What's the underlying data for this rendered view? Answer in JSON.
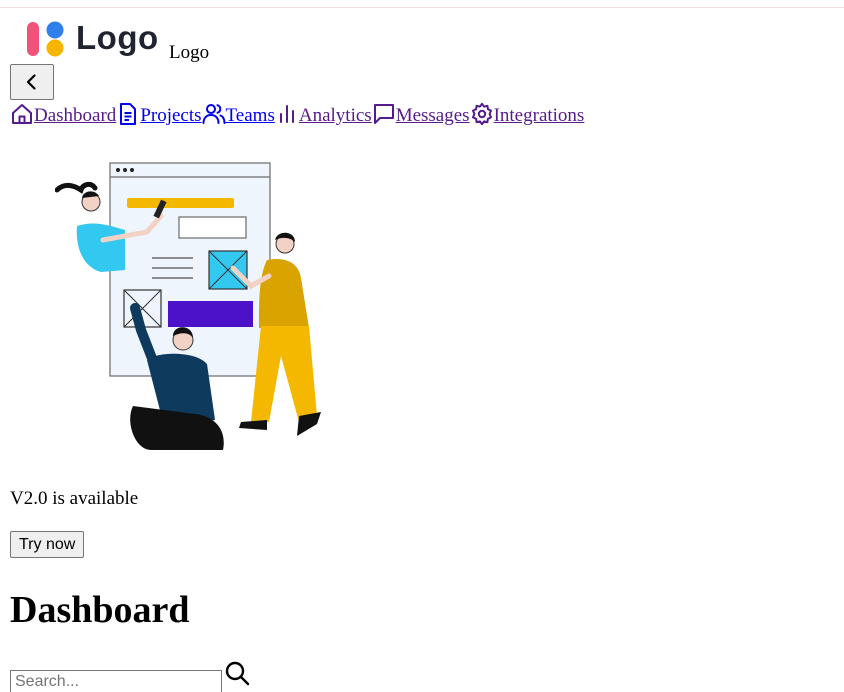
{
  "logo": {
    "wordmark": "Logo",
    "alt_text": "Logo"
  },
  "nav": {
    "back_icon": "chevron-left-icon",
    "items": [
      {
        "label": "Dashboard",
        "icon": "home-icon",
        "visited": true
      },
      {
        "label": "Projects",
        "icon": "document-icon",
        "visited": false
      },
      {
        "label": "Teams",
        "icon": "users-icon",
        "visited": false
      },
      {
        "label": "Analytics",
        "icon": "bar-chart-icon",
        "visited": true
      },
      {
        "label": "Messages",
        "icon": "message-icon",
        "visited": true
      },
      {
        "label": "Integrations",
        "icon": "gear-icon",
        "visited": true
      }
    ]
  },
  "promo": {
    "text": "V2.0 is available",
    "button_label": "Try now"
  },
  "page": {
    "title": "Dashboard"
  },
  "search": {
    "placeholder": "Search...",
    "icon": "search-icon"
  },
  "colors": {
    "visited_link": "#551a8b",
    "link": "#0000ee",
    "logo_pink": "#f0527a",
    "logo_blue": "#2f80ed",
    "logo_yellow": "#f7b500",
    "illustration_yellow": "#f5b800",
    "illustration_purple": "#4b12c9",
    "illustration_cyan": "#33c8ef",
    "illustration_navy": "#0e3a5e"
  }
}
